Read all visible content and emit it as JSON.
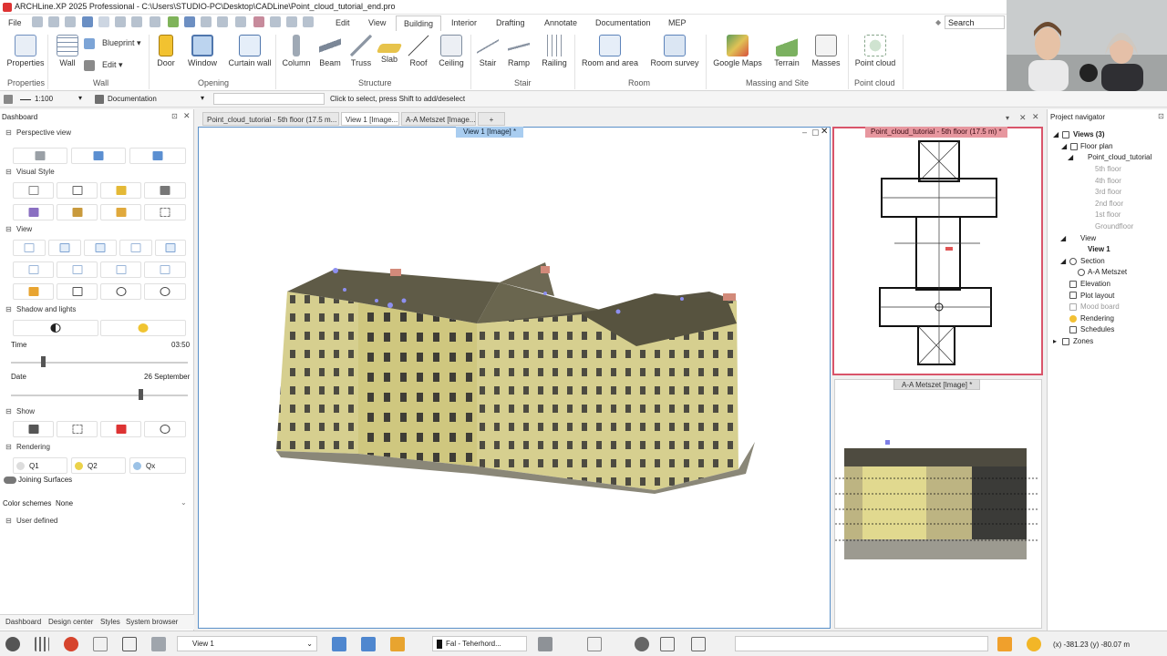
{
  "window": {
    "title": "ARCHLine.XP 2025 Professional - C:\\Users\\STUDIO-PC\\Desktop\\CADLine\\Point_cloud_tutorial_end.pro"
  },
  "menu": {
    "file": "File",
    "items": [
      "Edit",
      "View",
      "Building",
      "Interior",
      "Drafting",
      "Annotate",
      "Documentation",
      "MEP"
    ],
    "active": "Building",
    "search_placeholder": "Search"
  },
  "ribbon": {
    "properties": "Properties",
    "wall": "Wall",
    "blueprint": "Blueprint",
    "edit": "Edit",
    "door": "Door",
    "window": "Window",
    "curtain_wall": "Curtain wall",
    "column": "Column",
    "beam": "Beam",
    "truss": "Truss",
    "slab": "Slab",
    "roof": "Roof",
    "ceiling": "Ceiling",
    "stair": "Stair",
    "ramp": "Ramp",
    "railing": "Railing",
    "room_area": "Room and area",
    "room_survey": "Room survey",
    "google_maps": "Google Maps",
    "terrain": "Terrain",
    "masses": "Masses",
    "point_cloud": "Point cloud",
    "groups": {
      "properties": "Properties",
      "wall": "Wall",
      "opening": "Opening",
      "structure": "Structure",
      "stair": "Stair",
      "room": "Room",
      "massing": "Massing and Site",
      "point_cloud": "Point cloud"
    }
  },
  "options_bar": {
    "scale": "1:100",
    "layer": "Documentation",
    "hint": "Click to select, press Shift to add/deselect"
  },
  "dashboard": {
    "title": "Dashboard",
    "perspective": "Perspective view",
    "visual_style": "Visual Style",
    "view": "View",
    "shadow_lights": "Shadow and lights",
    "time_label": "Time",
    "time_value": "03:50",
    "time_level": 0.18,
    "date_label": "Date",
    "date_value": "26 September",
    "date_level": 0.73,
    "show": "Show",
    "rendering": "Rendering",
    "q1": "Q1",
    "q2": "Q2",
    "qx": "Qx",
    "joining": "Joining Surfaces",
    "color_schemes": "Color schemes",
    "color_schemes_value": "None",
    "user_defined": "User defined",
    "tabs": [
      "Dashboard",
      "Design center",
      "Styles",
      "System browser"
    ]
  },
  "doc_tabs": [
    "Point_cloud_tutorial - 5th floor (17.5 m...",
    "View 1 [Image...",
    "A-A Metszet [Image...",
    "+"
  ],
  "views": {
    "view1_label": "View 1 [Image] *",
    "floorplan_label": "Point_cloud_tutorial - 5th floor (17.5 m) *",
    "section_label": "A-A Metszet [Image] *"
  },
  "navigator": {
    "title": "Project navigator",
    "views_root": "Views (3)",
    "floor_plan": "Floor plan",
    "project": "Point_cloud_tutorial",
    "floors": [
      "5th floor",
      "4th floor",
      "3rd floor",
      "2nd floor",
      "1st floor",
      "Groundfloor"
    ],
    "view": "View",
    "view1": "View 1",
    "section": "Section",
    "section_item": "A-A Metszet",
    "elevation": "Elevation",
    "plot_layout": "Plot layout",
    "mood_board": "Mood board",
    "rendering": "Rendering",
    "schedules": "Schedules",
    "zones": "Zones"
  },
  "statusbar": {
    "view_select": "View 1",
    "layer_value": "Fal - Teherhord...",
    "coords": "(x) -381.23  (y) -80.07 m"
  },
  "colors": {
    "accent_blue": "#5a90c9",
    "floorplan_red": "#d9546a",
    "building_wall": "#d6cf8f",
    "roof": "#5f5b47"
  }
}
